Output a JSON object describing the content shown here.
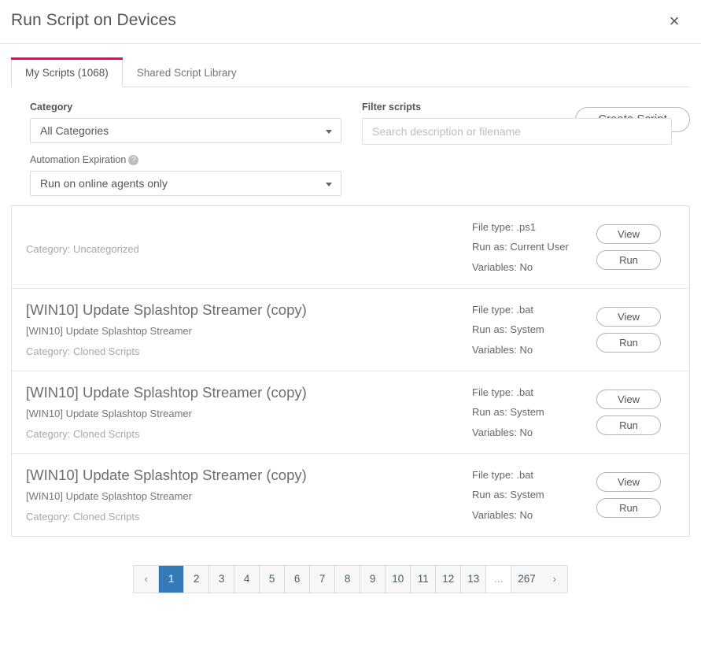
{
  "theme": {
    "accent": "#f50057",
    "pagination_active": "#337ab7"
  },
  "header": {
    "title": "Run Script on Devices",
    "close_icon": "×"
  },
  "tabs": [
    {
      "label": "My Scripts (1068)",
      "active": true
    },
    {
      "label": "Shared Script Library",
      "active": false
    }
  ],
  "toolbar": {
    "create_script_label": "Create Script"
  },
  "filters": {
    "category_label": "Category",
    "category_value": "All Categories",
    "automation_expiration_label": "Automation Expiration",
    "automation_expiration_help": "?",
    "automation_expiration_value": "Run on online agents only",
    "filter_scripts_label": "Filter scripts",
    "search_value": "",
    "search_placeholder": "Search description or filename"
  },
  "scripts": [
    {
      "title": "",
      "description": "",
      "category": "Category: Uncategorized",
      "file_type": "File type: .ps1",
      "run_as": "Run as: Current User",
      "variables": "Variables: No",
      "view_label": "View",
      "run_label": "Run"
    },
    {
      "title": "[WIN10] Update Splashtop Streamer (copy)",
      "description": "[WIN10] Update Splashtop Streamer",
      "category": "Category: Cloned Scripts",
      "file_type": "File type: .bat",
      "run_as": "Run as: System",
      "variables": "Variables: No",
      "view_label": "View",
      "run_label": "Run"
    },
    {
      "title": "[WIN10] Update Splashtop Streamer (copy)",
      "description": "[WIN10] Update Splashtop Streamer",
      "category": "Category: Cloned Scripts",
      "file_type": "File type: .bat",
      "run_as": "Run as: System",
      "variables": "Variables: No",
      "view_label": "View",
      "run_label": "Run"
    },
    {
      "title": "[WIN10] Update Splashtop Streamer (copy)",
      "description": "[WIN10] Update Splashtop Streamer",
      "category": "Category: Cloned Scripts",
      "file_type": "File type: .bat",
      "run_as": "Run as: System",
      "variables": "Variables: No",
      "view_label": "View",
      "run_label": "Run"
    }
  ],
  "pagination": {
    "prev_label": "‹",
    "next_label": "›",
    "pages": [
      "1",
      "2",
      "3",
      "4",
      "5",
      "6",
      "7",
      "8",
      "9",
      "10",
      "11",
      "12",
      "13",
      "...",
      "267"
    ],
    "active_page": "1",
    "ellipsis_token": "..."
  }
}
